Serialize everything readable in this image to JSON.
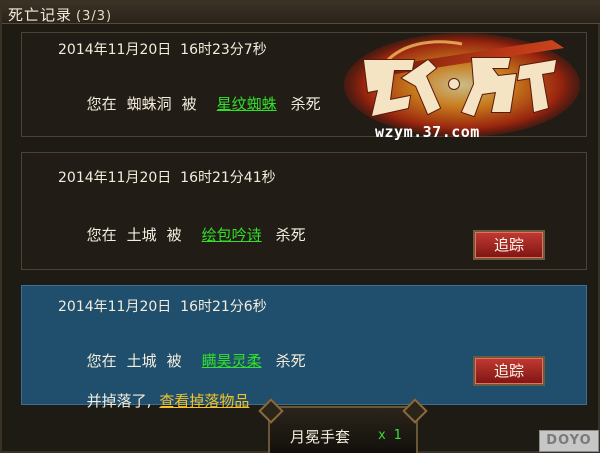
{
  "window": {
    "title": "死亡记录",
    "count": "(3/3)"
  },
  "records": [
    {
      "timestamp": "2014年11月20日  16时23分7秒",
      "prefix": "您在",
      "location": "蜘蛛洞",
      "by": "被",
      "killer": "星纹蜘蛛",
      "suffix": "杀死"
    },
    {
      "timestamp": "2014年11月20日  16时21分41秒",
      "prefix": "您在",
      "location": "土城",
      "by": "被",
      "killer": "绘包吟诗",
      "suffix": "杀死",
      "track_label": "追踪"
    },
    {
      "timestamp": "2014年11月20日  16时21分6秒",
      "prefix": "您在",
      "location": "土城",
      "by": "被",
      "killer": "瞒昊灵柔",
      "suffix": "杀死",
      "drop_text": "并掉落了,",
      "drop_link": "查看掉落物品",
      "track_label": "追踪"
    }
  ],
  "item_tab": {
    "name": "月冕手套",
    "quantity": "x 1"
  },
  "logo": {
    "game_name": "武之影魅",
    "url": "wzym.37.com"
  },
  "watermark": "DOYO",
  "colors": {
    "killer_link": "#32e02a",
    "drop_link": "#f2c12e",
    "selected_card": "#1f4f6c",
    "track_button": "#a32a24"
  }
}
